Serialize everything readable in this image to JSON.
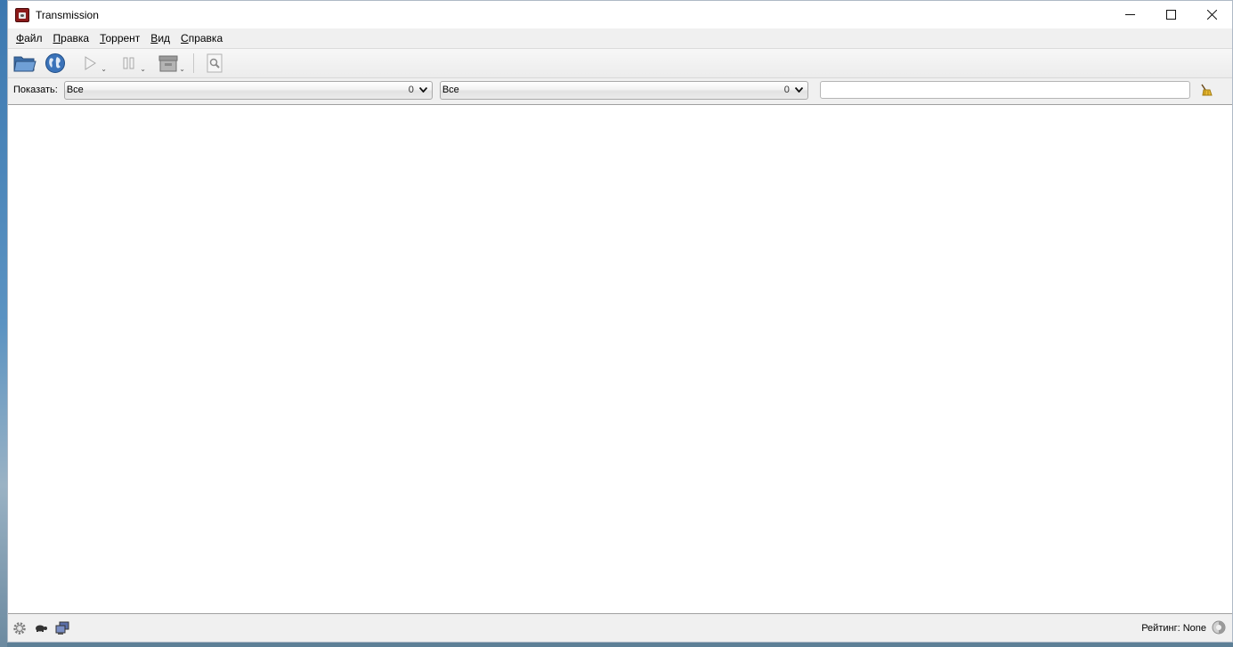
{
  "window": {
    "title": "Transmission"
  },
  "menu": {
    "items": [
      {
        "first": "Ф",
        "rest": "айл"
      },
      {
        "first": "П",
        "rest": "равка"
      },
      {
        "first": "Т",
        "rest": "оррент"
      },
      {
        "first": "В",
        "rest": "ид"
      },
      {
        "first": "С",
        "rest": "правка"
      }
    ]
  },
  "toolbar": {
    "icons": [
      "open-folder-icon",
      "globe-icon",
      "play-icon",
      "pause-icon",
      "remove-icon",
      "properties-icon"
    ]
  },
  "filter": {
    "show_label": "Показать:",
    "status_combo": {
      "value": "Все",
      "count": "0"
    },
    "tracker_combo": {
      "value": "Все",
      "count": "0"
    },
    "search_value": ""
  },
  "statusbar": {
    "ratio_label": "Рейтинг: None"
  },
  "colors": {
    "window_bg": "#f0f0f0",
    "list_bg": "#ffffff",
    "titlebar_bg": "#ffffff"
  }
}
